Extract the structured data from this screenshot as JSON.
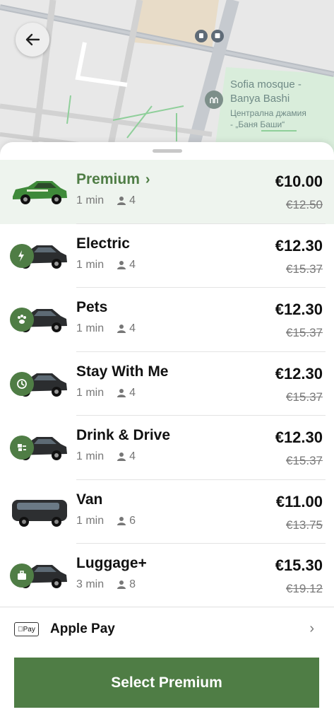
{
  "map": {
    "poi_name_en": "Sofia mosque -\nBanya Bashi",
    "poi_name_bg": "Централна джамия\n- „Баня Баши“"
  },
  "rides": [
    {
      "name": "Premium",
      "eta": "1 min",
      "seats": "4",
      "price": "€10.00",
      "old_price": "€12.50",
      "selected": true,
      "badge_icon": "none"
    },
    {
      "name": "Electric",
      "eta": "1 min",
      "seats": "4",
      "price": "€12.30",
      "old_price": "€15.37",
      "selected": false,
      "badge_icon": "lightning-icon"
    },
    {
      "name": "Pets",
      "eta": "1 min",
      "seats": "4",
      "price": "€12.30",
      "old_price": "€15.37",
      "selected": false,
      "badge_icon": "paw-icon"
    },
    {
      "name": "Stay With Me",
      "eta": "1 min",
      "seats": "4",
      "price": "€12.30",
      "old_price": "€15.37",
      "selected": false,
      "badge_icon": "clock-icon"
    },
    {
      "name": "Drink & Drive",
      "eta": "1 min",
      "seats": "4",
      "price": "€12.30",
      "old_price": "€15.37",
      "selected": false,
      "badge_icon": "keys-icon"
    },
    {
      "name": "Van",
      "eta": "1 min",
      "seats": "6",
      "price": "€11.00",
      "old_price": "€13.75",
      "selected": false,
      "badge_icon": "none"
    },
    {
      "name": "Luggage+",
      "eta": "3 min",
      "seats": "8",
      "price": "€15.30",
      "old_price": "€19.12",
      "selected": false,
      "badge_icon": "suitcase-icon"
    }
  ],
  "payment": {
    "badge": "Pay",
    "label": "Apple Pay"
  },
  "cta": {
    "label": "Select Premium"
  },
  "colors": {
    "accent": "#4f7d45",
    "selected_bg": "#eef4ee"
  }
}
